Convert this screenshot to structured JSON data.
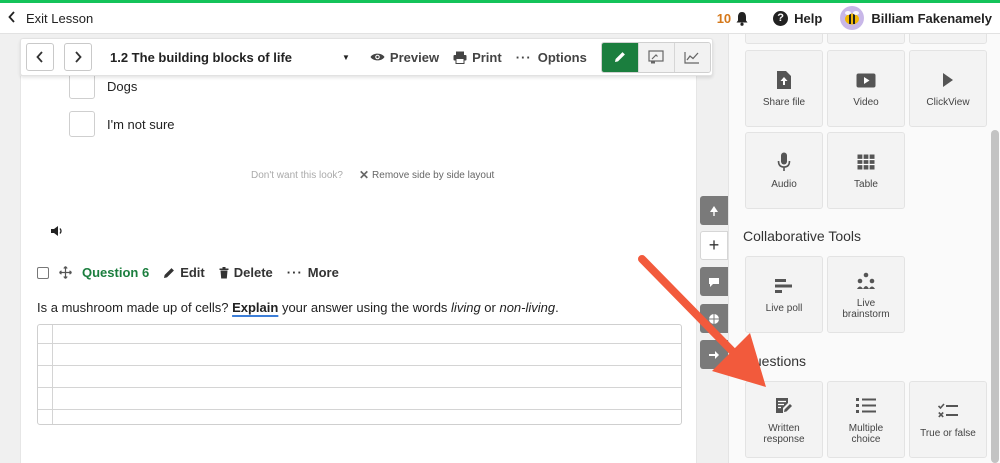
{
  "colors": {
    "accent_green": "#14c35a",
    "brand_green": "#1b7e3e",
    "notification_orange": "#d5781a",
    "arrow_red": "#f25a3c"
  },
  "topbar": {
    "exit_label": "Exit Lesson",
    "notification_count": "10",
    "help_label": "Help",
    "user_name": "Billiam Fakenamely"
  },
  "lesson_toolbar": {
    "title": "1.2 The building blocks of life",
    "preview_label": "Preview",
    "print_label": "Print",
    "options_label": "Options"
  },
  "content": {
    "options": [
      {
        "label": "Dogs"
      },
      {
        "label": "I'm not sure"
      }
    ],
    "layout_hint": "Don't want this look?",
    "remove_layout_label": "Remove side by side layout",
    "question": {
      "label": "Question 6",
      "edit_label": "Edit",
      "delete_label": "Delete",
      "more_label": "More",
      "text_parts": {
        "p1": "Is a mushroom made up of cells? ",
        "explain": "Explain",
        "p2": " your answer using the words ",
        "living": "living",
        "or": " or ",
        "non_living": "non-living",
        "end": "."
      }
    }
  },
  "panel": {
    "media_tiles": [
      {
        "label": "Share file",
        "icon": "share-file-icon"
      },
      {
        "label": "Video",
        "icon": "video-icon"
      },
      {
        "label": "ClickView",
        "icon": "play-icon"
      },
      {
        "label": "Audio",
        "icon": "microphone-icon"
      },
      {
        "label": "Table",
        "icon": "table-icon"
      }
    ],
    "collaborative_title": "Collaborative Tools",
    "collaborative_tiles": [
      {
        "label": "Live poll",
        "icon": "poll-icon"
      },
      {
        "label": "Live brainstorm",
        "icon": "brainstorm-icon"
      }
    ],
    "questions_title": "Questions",
    "question_tiles": [
      {
        "label": "Written response",
        "icon": "written-response-icon"
      },
      {
        "label": "Multiple choice",
        "icon": "list-icon"
      },
      {
        "label": "True or false",
        "icon": "checklist-icon"
      }
    ]
  }
}
